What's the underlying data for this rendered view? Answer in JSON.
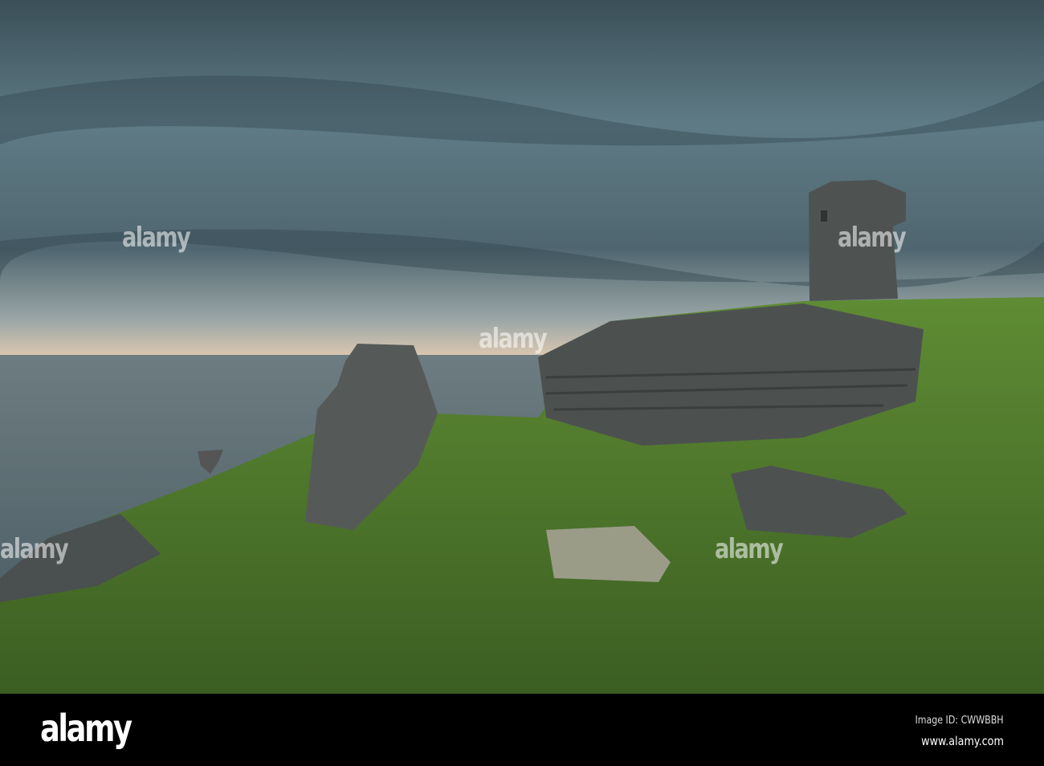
{
  "photo": {
    "subject": "ruined stone tower on grassy sea cliff under stormy sky",
    "colors": {
      "sky_top": "#3d535c",
      "sky_mid": "#6d8790",
      "horizon": "#d8c8b4",
      "sea": "#5d6e74",
      "grass": "#4e7a2c",
      "rock": "#4a4f4f"
    }
  },
  "watermark": {
    "text": "alamy"
  },
  "footer": {
    "logo": "alamy",
    "image_id": "Image ID: CWWBBH",
    "url": "www.alamy.com"
  }
}
